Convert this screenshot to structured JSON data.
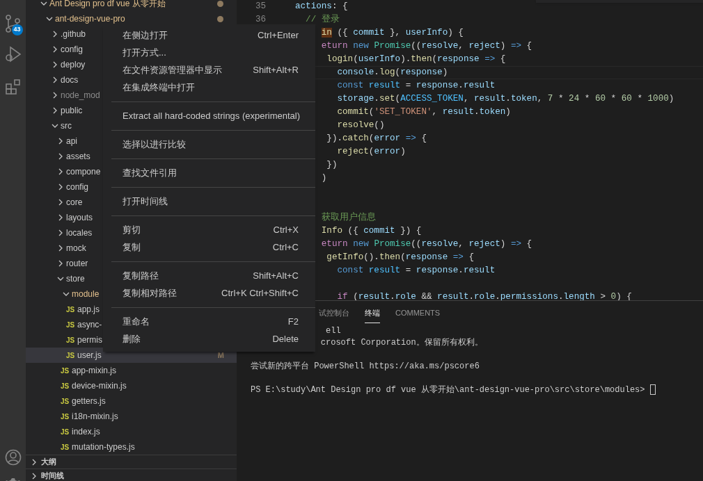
{
  "activity_bar": {
    "badge": "43"
  },
  "explorer": {
    "rows": [
      {
        "label": "Ant Design pro df vue 从零开始",
        "kind": "folder",
        "expanded": true,
        "modified": true,
        "dot": true,
        "children": [
          {
            "label": "ant-design-vue-pro",
            "kind": "folder",
            "expanded": true,
            "modified": true,
            "dot": true,
            "children": [
              {
                "label": ".github",
                "kind": "folder",
                "expanded": false
              },
              {
                "label": "config",
                "kind": "folder",
                "expanded": false
              },
              {
                "label": "deploy",
                "kind": "folder",
                "expanded": false
              },
              {
                "label": "docs",
                "kind": "folder",
                "expanded": false
              },
              {
                "label": "node_mod",
                "kind": "folder",
                "expanded": false,
                "ignored": true
              },
              {
                "label": "public",
                "kind": "folder",
                "expanded": false
              },
              {
                "label": "src",
                "kind": "folder",
                "expanded": true,
                "children": [
                  {
                    "label": "api",
                    "kind": "folder",
                    "expanded": false
                  },
                  {
                    "label": "assets",
                    "kind": "folder",
                    "expanded": false
                  },
                  {
                    "label": "compone",
                    "kind": "folder",
                    "expanded": false
                  },
                  {
                    "label": "config",
                    "kind": "folder",
                    "expanded": false
                  },
                  {
                    "label": "core",
                    "kind": "folder",
                    "expanded": false
                  },
                  {
                    "label": "layouts",
                    "kind": "folder",
                    "expanded": false
                  },
                  {
                    "label": "locales",
                    "kind": "folder",
                    "expanded": false
                  },
                  {
                    "label": "mock",
                    "kind": "folder",
                    "expanded": false
                  },
                  {
                    "label": "router",
                    "kind": "folder",
                    "expanded": false
                  },
                  {
                    "label": "store",
                    "kind": "folder",
                    "expanded": true,
                    "children": [
                      {
                        "label": "module",
                        "kind": "folder",
                        "expanded": true,
                        "modified": true,
                        "children": [
                          {
                            "label": "app.js",
                            "kind": "file",
                            "icon": "JS",
                            "selected": false
                          },
                          {
                            "label": "async-",
                            "kind": "file",
                            "icon": "JS",
                            "selected": false
                          },
                          {
                            "label": "permis",
                            "kind": "file",
                            "icon": "JS",
                            "selected": false
                          },
                          {
                            "label": "user.js",
                            "kind": "file",
                            "icon": "JS",
                            "selected": true,
                            "badge": "M"
                          }
                        ]
                      },
                      {
                        "label": "app-mixin.js",
                        "kind": "file",
                        "icon": "JS",
                        "selected": false
                      },
                      {
                        "label": "device-mixin.js",
                        "kind": "file",
                        "icon": "JS",
                        "selected": false
                      },
                      {
                        "label": "getters.js",
                        "kind": "file",
                        "icon": "JS",
                        "selected": false
                      },
                      {
                        "label": "i18n-mixin.js",
                        "kind": "file",
                        "icon": "JS",
                        "selected": false
                      },
                      {
                        "label": "index.js",
                        "kind": "file",
                        "icon": "JS",
                        "selected": false
                      },
                      {
                        "label": "mutation-types.js",
                        "kind": "file",
                        "icon": "JS",
                        "selected": false
                      }
                    ]
                  }
                ]
              }
            ]
          }
        ]
      }
    ],
    "sections": [
      {
        "label": "大纲",
        "expanded": false
      },
      {
        "label": "时间线",
        "expanded": false
      }
    ]
  },
  "editor": {
    "lines": [
      {
        "number": "35",
        "tokens": [
          {
            "kind": "var",
            "text": "actions"
          },
          {
            "kind": "p",
            "text": ": {"
          }
        ]
      },
      {
        "number": "36",
        "tokens": [
          {
            "kind": "cm",
            "text": "// 登录"
          }
        ]
      },
      {
        "tokens": [
          {
            "kind": "hl",
            "text": "in"
          },
          {
            "kind": "p",
            "text": " ({ "
          },
          {
            "kind": "var",
            "text": "commit"
          },
          {
            "kind": "p",
            "text": " }, "
          },
          {
            "kind": "var",
            "text": "userInfo"
          },
          {
            "kind": "p",
            "text": ") {"
          }
        ]
      },
      {
        "tokens": [
          {
            "kind": "ctrl",
            "text": "eturn "
          },
          {
            "kind": "kw",
            "text": "new "
          },
          {
            "kind": "cls",
            "text": "Promise"
          },
          {
            "kind": "p",
            "text": "(("
          },
          {
            "kind": "var",
            "text": "resolve"
          },
          {
            "kind": "p",
            "text": ", "
          },
          {
            "kind": "var",
            "text": "reject"
          },
          {
            "kind": "p",
            "text": ") "
          },
          {
            "kind": "kw",
            "text": "=> "
          },
          {
            "kind": "p",
            "text": "{"
          }
        ]
      },
      {
        "tokens": [
          {
            "kind": "fn",
            "text": "login"
          },
          {
            "kind": "p",
            "text": "("
          },
          {
            "kind": "var",
            "text": "userInfo"
          },
          {
            "kind": "p",
            "text": ")."
          },
          {
            "kind": "fn",
            "text": "then"
          },
          {
            "kind": "p",
            "text": "("
          },
          {
            "kind": "var",
            "text": "response "
          },
          {
            "kind": "kw",
            "text": "=> "
          },
          {
            "kind": "p",
            "text": "{"
          }
        ]
      },
      {
        "current": true,
        "tokens": [
          {
            "kind": "var",
            "text": "console"
          },
          {
            "kind": "p",
            "text": "."
          },
          {
            "kind": "fn",
            "text": "log"
          },
          {
            "kind": "p",
            "text": "("
          },
          {
            "kind": "var",
            "text": "response"
          },
          {
            "kind": "p",
            "text": ")"
          }
        ]
      },
      {
        "tokens": [
          {
            "kind": "kw",
            "text": "const "
          },
          {
            "kind": "const",
            "text": "result"
          },
          {
            "kind": "p",
            "text": " = "
          },
          {
            "kind": "var",
            "text": "response"
          },
          {
            "kind": "p",
            "text": "."
          },
          {
            "kind": "var",
            "text": "result"
          }
        ]
      },
      {
        "tokens": [
          {
            "kind": "var",
            "text": "storage"
          },
          {
            "kind": "p",
            "text": "."
          },
          {
            "kind": "fn",
            "text": "set"
          },
          {
            "kind": "p",
            "text": "("
          },
          {
            "kind": "const",
            "text": "ACCESS_TOKEN"
          },
          {
            "kind": "p",
            "text": ", "
          },
          {
            "kind": "var",
            "text": "result"
          },
          {
            "kind": "p",
            "text": "."
          },
          {
            "kind": "var",
            "text": "token"
          },
          {
            "kind": "p",
            "text": ", "
          },
          {
            "kind": "num",
            "text": "7"
          },
          {
            "kind": "p",
            "text": " * "
          },
          {
            "kind": "num",
            "text": "24"
          },
          {
            "kind": "p",
            "text": " * "
          },
          {
            "kind": "num",
            "text": "60"
          },
          {
            "kind": "p",
            "text": " * "
          },
          {
            "kind": "num",
            "text": "60"
          },
          {
            "kind": "p",
            "text": " * "
          },
          {
            "kind": "num",
            "text": "1000"
          },
          {
            "kind": "p",
            "text": ")"
          }
        ]
      },
      {
        "tokens": [
          {
            "kind": "fn",
            "text": "commit"
          },
          {
            "kind": "p",
            "text": "("
          },
          {
            "kind": "str",
            "text": "'SET_TOKEN'"
          },
          {
            "kind": "p",
            "text": ", "
          },
          {
            "kind": "var",
            "text": "result"
          },
          {
            "kind": "p",
            "text": "."
          },
          {
            "kind": "var",
            "text": "token"
          },
          {
            "kind": "p",
            "text": ")"
          }
        ]
      },
      {
        "tokens": [
          {
            "kind": "fn",
            "text": "resolve"
          },
          {
            "kind": "p",
            "text": "()"
          }
        ]
      },
      {
        "tokens": [
          {
            "kind": "p",
            "text": "})."
          },
          {
            "kind": "fn",
            "text": "catch"
          },
          {
            "kind": "p",
            "text": "("
          },
          {
            "kind": "var",
            "text": "error "
          },
          {
            "kind": "kw",
            "text": "=> "
          },
          {
            "kind": "p",
            "text": "{"
          }
        ]
      },
      {
        "tokens": [
          {
            "kind": "fn",
            "text": "reject"
          },
          {
            "kind": "p",
            "text": "("
          },
          {
            "kind": "var",
            "text": "error"
          },
          {
            "kind": "p",
            "text": ")"
          }
        ]
      },
      {
        "tokens": [
          {
            "kind": "p",
            "text": "})"
          }
        ]
      },
      {
        "tokens": [
          {
            "kind": "p",
            "text": ")"
          }
        ]
      },
      {
        "tokens": [
          {
            "kind": "cm",
            "text": "获取用户信息"
          }
        ]
      },
      {
        "tokens": [
          {
            "kind": "fn",
            "text": "Info"
          },
          {
            "kind": "p",
            "text": " ({ "
          },
          {
            "kind": "var",
            "text": "commit"
          },
          {
            "kind": "p",
            "text": " }) {"
          }
        ]
      },
      {
        "tokens": [
          {
            "kind": "ctrl",
            "text": "eturn "
          },
          {
            "kind": "kw",
            "text": "new "
          },
          {
            "kind": "cls",
            "text": "Promise"
          },
          {
            "kind": "p",
            "text": "(("
          },
          {
            "kind": "var",
            "text": "resolve"
          },
          {
            "kind": "p",
            "text": ", "
          },
          {
            "kind": "var",
            "text": "reject"
          },
          {
            "kind": "p",
            "text": ") "
          },
          {
            "kind": "kw",
            "text": "=> "
          },
          {
            "kind": "p",
            "text": "{"
          }
        ]
      },
      {
        "tokens": [
          {
            "kind": "fn",
            "text": "getInfo"
          },
          {
            "kind": "p",
            "text": "()."
          },
          {
            "kind": "fn",
            "text": "then"
          },
          {
            "kind": "p",
            "text": "("
          },
          {
            "kind": "var",
            "text": "response "
          },
          {
            "kind": "kw",
            "text": "=> "
          },
          {
            "kind": "p",
            "text": "{"
          }
        ]
      },
      {
        "tokens": [
          {
            "kind": "kw",
            "text": "const "
          },
          {
            "kind": "const",
            "text": "result"
          },
          {
            "kind": "p",
            "text": " = "
          },
          {
            "kind": "var",
            "text": "response"
          },
          {
            "kind": "p",
            "text": "."
          },
          {
            "kind": "var",
            "text": "result"
          }
        ]
      },
      {
        "tokens": [
          {
            "kind": "ctrl",
            "text": "if"
          },
          {
            "kind": "p",
            "text": " ("
          },
          {
            "kind": "var",
            "text": "result"
          },
          {
            "kind": "p",
            "text": "."
          },
          {
            "kind": "var",
            "text": "role"
          },
          {
            "kind": "p",
            "text": " && "
          },
          {
            "kind": "var",
            "text": "result"
          },
          {
            "kind": "p",
            "text": "."
          },
          {
            "kind": "var",
            "text": "role"
          },
          {
            "kind": "p",
            "text": "."
          },
          {
            "kind": "var",
            "text": "permissions"
          },
          {
            "kind": "p",
            "text": "."
          },
          {
            "kind": "var",
            "text": "length"
          },
          {
            "kind": "p",
            "text": " > "
          },
          {
            "kind": "num",
            "text": "0"
          },
          {
            "kind": "p",
            "text": ") {"
          }
        ]
      }
    ]
  },
  "panel": {
    "tabs": [
      {
        "label": "试控制台",
        "selected": false
      },
      {
        "label": "终端",
        "selected": true
      },
      {
        "label": "COMMENTS",
        "selected": false
      }
    ],
    "terminal": [
      {
        "text": "ell"
      },
      {
        "text": "crosoft Corporation。保留所有权利。"
      },
      {
        "text": "尝试新的跨平台 PowerShell https://aka.ms/pscore6"
      },
      {
        "text": "PS E:\\study\\Ant Design pro df vue 从零开始\\ant-design-vue-pro\\src\\store\\modules> ",
        "cursor": true
      }
    ]
  },
  "context_menu": {
    "groups": [
      [
        {
          "label": "在侧边打开",
          "shortcut": "Ctrl+Enter"
        },
        {
          "label": "打开方式..."
        },
        {
          "label": "在文件资源管理器中显示",
          "shortcut": "Shift+Alt+R"
        },
        {
          "label": "在集成终端中打开"
        }
      ],
      [
        {
          "label": "Extract all hard-coded strings (experimental)"
        }
      ],
      [
        {
          "label": "选择以进行比较"
        }
      ],
      [
        {
          "label": "查找文件引用"
        }
      ],
      [
        {
          "label": "打开时间线"
        }
      ],
      [
        {
          "label": "剪切",
          "shortcut": "Ctrl+X"
        },
        {
          "label": "复制",
          "shortcut": "Ctrl+C"
        }
      ],
      [
        {
          "label": "复制路径",
          "shortcut": "Shift+Alt+C"
        },
        {
          "label": "复制相对路径",
          "shortcut": "Ctrl+K Ctrl+Shift+C"
        }
      ],
      [
        {
          "label": "重命名",
          "shortcut": "F2"
        },
        {
          "label": "删除",
          "shortcut": "Delete"
        }
      ]
    ]
  }
}
